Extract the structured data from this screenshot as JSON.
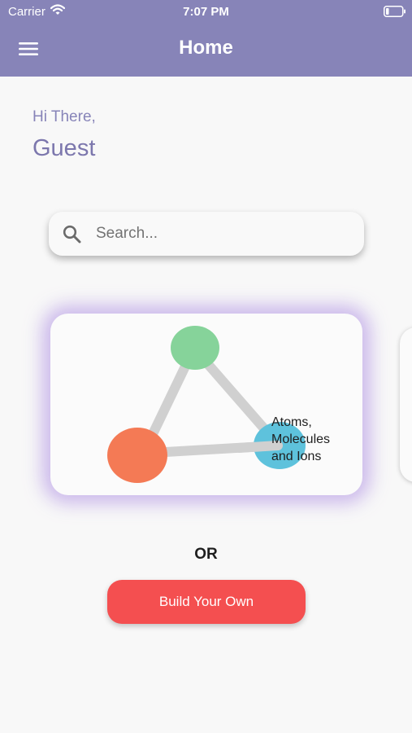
{
  "status_bar": {
    "carrier": "Carrier",
    "time": "7:07 PM",
    "wifi_icon": "wifi-icon",
    "battery_icon": "battery-icon"
  },
  "nav": {
    "title": "Home",
    "menu_icon": "menu-icon"
  },
  "greeting": {
    "line1": "Hi There,",
    "name": "Guest"
  },
  "search": {
    "placeholder": "Search...",
    "value": "",
    "icon": "search-icon"
  },
  "topics": [
    {
      "label": "Atoms, Molecules and Ions",
      "diagram_colors": {
        "top_atom": "#86d39a",
        "left_atom": "#f47a55",
        "right_atom": "#5ec2dc",
        "bonds": "#d0d0d0"
      }
    }
  ],
  "divider_text": "OR",
  "build_button": {
    "label": "Build Your Own"
  },
  "colors": {
    "header": "#8784b8",
    "accent": "#8784b8",
    "button": "#f44f50",
    "card_glow": "#baa0e6"
  }
}
